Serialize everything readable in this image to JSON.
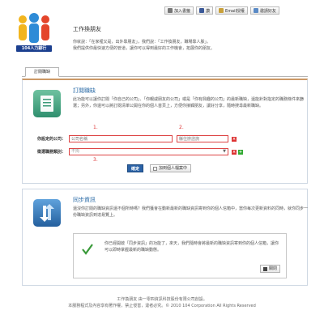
{
  "topbar": {
    "items": [
      {
        "label": "加入書籤",
        "icon": "bookmark-icon"
      },
      {
        "label": "讚",
        "icon": "facebook-icon"
      },
      {
        "label": "Email授權",
        "icon": "mail-icon"
      },
      {
        "label": "邀請好友",
        "icon": "user-icon"
      }
    ]
  },
  "logo": {
    "text": "104人力銀行"
  },
  "intro": {
    "title": "工作換朋友",
    "lines": [
      "你就說：「在家裡又是，出外靠朋友」，我們說：「工作換朋友，職場靠人脈」。",
      "我們提供你最快速方便的管道，讓你可以得到最好的工作機會，拓展你的朋友。"
    ]
  },
  "tabs": [
    {
      "label": "訂閱職缺"
    }
  ],
  "subscribe": {
    "title": "訂閱職缺",
    "desc": "此功能可以讓你訂閱「你自己的公司」、「你親戚朋友的公司」或是「你有興趣的公司」的最新職缺，還能針對指定的職務條件來篩選；另外，你還可以將訂閱清單公開在你的個人首頁上，方便你接觸朋友，讓好分享，隨時搜尋最新職缺。",
    "company_label": "你設定的公司：",
    "company_placeholder": "公司名稱",
    "region_placeholder": "縣住辦諮詢",
    "category_label": "徵選職務類別：",
    "category_value": "不拘",
    "markers": [
      "1.",
      "2.",
      "3."
    ],
    "x_glyph": "×",
    "plus_glyph": "+",
    "confirm_label": "確定",
    "personal_label": "加到個人檔案中"
  },
  "sync": {
    "title": "同步資訊",
    "desc": "還沒你訂閱的職缺資訊還不個所時嗎？我們獲會在動新最新的職缺資訊寄到你的個人信箱中，當你每次更新資料的同時，就你同步一份職缺資訊到達易覽上。",
    "notice_text": "你已經開啟「同步資訊」的功能了，來天，我們隨時會將最新的職缺資訊寄到你的個人信箱，讓你可以即時掌握最新的職缺動態。",
    "close_label": "關閉"
  },
  "footer": {
    "line1": "工作換朋友 由一零四資訊科技股份有限公司創設。",
    "line2": "本服務程式及內容享有著作權，禁止侵害，違者必究。© 2010 104 Corporation All Rights Reserved"
  },
  "colors": {
    "accent_blue": "#2f6ea8",
    "error_red": "#dd3333",
    "brand_navy": "#1b3f8f"
  }
}
